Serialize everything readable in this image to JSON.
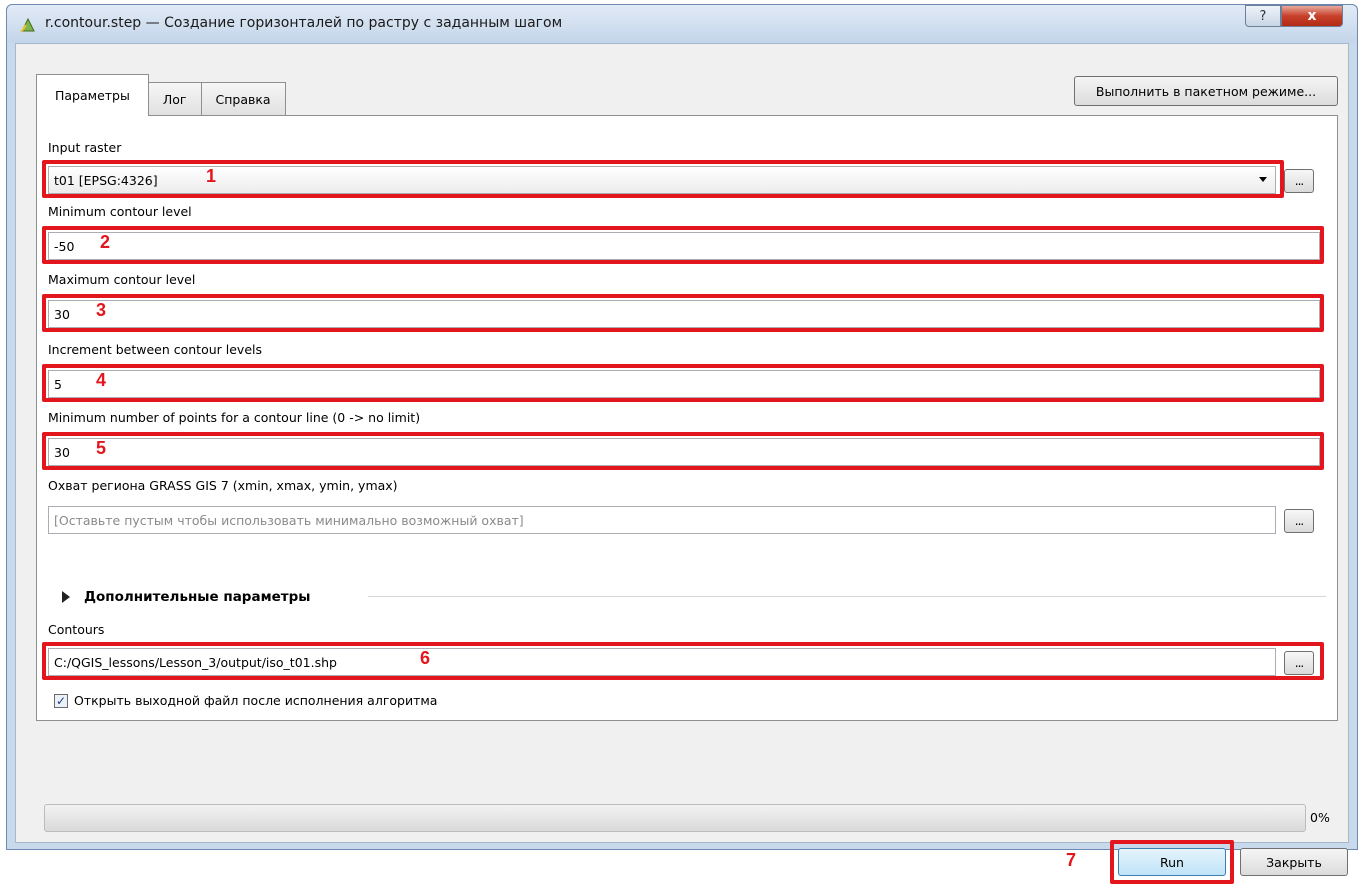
{
  "window": {
    "title": "r.contour.step — Создание горизонталей по растру с заданным шагом",
    "help_label": "?",
    "close_label": "x"
  },
  "tabs": [
    {
      "label": "Параметры",
      "active": true
    },
    {
      "label": "Лог",
      "active": false
    },
    {
      "label": "Справка",
      "active": false
    }
  ],
  "batch_button": "Выполнить в пакетном режиме...",
  "fields": {
    "input_raster": {
      "label": "Input raster",
      "value": "t01 [EPSG:4326]"
    },
    "min_level": {
      "label": "Minimum contour level",
      "value": "-50"
    },
    "max_level": {
      "label": "Maximum contour level",
      "value": "30"
    },
    "increment": {
      "label": "Increment between contour levels",
      "value": "5"
    },
    "min_points": {
      "label": "Minimum number of points for a contour line (0 -> no limit)",
      "value": "30"
    },
    "region": {
      "label": "Охват региона GRASS GIS 7 (xmin, xmax, ymin, ymax)",
      "placeholder": "[Оставьте пустым чтобы использовать минимально возможный охват]"
    },
    "contours": {
      "label": "Contours",
      "value": "C:/QGIS_lessons/Lesson_3/output/iso_t01.shp"
    }
  },
  "browse_label": "...",
  "advanced_label": "Дополнительные параметры",
  "open_output": {
    "checked": true,
    "mark": "✓",
    "label": "Открыть выходной файл после исполнения алгоритма"
  },
  "progress": {
    "value": 0,
    "label": "0%"
  },
  "buttons": {
    "run": "Run",
    "close": "Закрыть"
  },
  "annotations": [
    "1",
    "2",
    "3",
    "4",
    "5",
    "6",
    "7"
  ],
  "colors": {
    "highlight": "#e4161d",
    "progress_fill": "#3cb33c"
  }
}
